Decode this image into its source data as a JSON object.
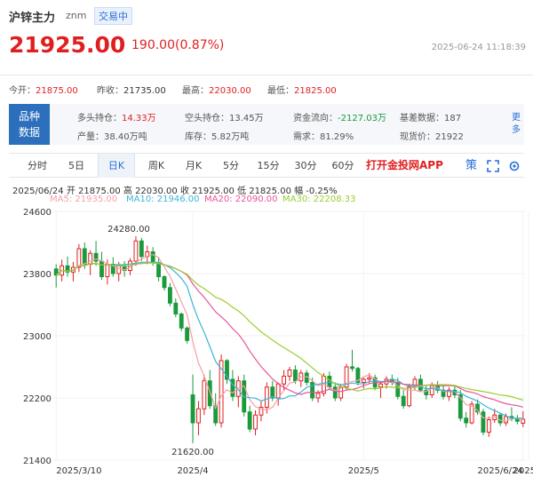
{
  "header": {
    "title": "沪锌主力",
    "code": "znm",
    "status_badge": "交易中",
    "price": "21925.00",
    "change": "190.00(0.87%)",
    "timestamp": "2025-06-24 11:18:39"
  },
  "quote_stats": {
    "open_label": "今开：",
    "open": "21875.00",
    "prev_close_label": "昨收：",
    "prev_close": "21735.00",
    "high_label": "最高：",
    "high": "22030.00",
    "low_label": "最低：",
    "low": "21825.00"
  },
  "info_panel": {
    "label_line1": "品种",
    "label_line2": "数据",
    "long_pos_label": "多头持仓：",
    "long_pos": "14.33万",
    "short_pos_label": "空头持仓：",
    "short_pos": "13.45万",
    "fund_flow_label": "资金流向：",
    "fund_flow": "-2127.03万",
    "basis_label": "基差数据：",
    "basis": "187",
    "output_label": "产量：",
    "output": "38.40万吨",
    "inventory_label": "库存：",
    "inventory": "5.82万吨",
    "demand_label": "需求：",
    "demand": "81.29%",
    "spot_label": "现货价：",
    "spot": "21922",
    "more": "更多"
  },
  "tabs": [
    {
      "label": "分时"
    },
    {
      "label": "5日"
    },
    {
      "label": "日K"
    },
    {
      "label": "周K"
    },
    {
      "label": "月K"
    },
    {
      "label": "5分"
    },
    {
      "label": "15分"
    },
    {
      "label": "30分"
    },
    {
      "label": "60分"
    }
  ],
  "active_tab": "日K",
  "app_link": "打开金投网APP",
  "strategy_icon_label": "策",
  "ohlc_line": "2025/06/24  开 21875.00  高 22030.00  收 21925.00  低 21825.00  幅 -0.25%",
  "ma_legend": [
    {
      "label": "MA5: 21935.00",
      "color": "#f5a0a8"
    },
    {
      "label": "MA10: 21946.00",
      "color": "#3bb5d8"
    },
    {
      "label": "MA20: 22090.00",
      "color": "#e8559a"
    },
    {
      "label": "MA30: 22208.33",
      "color": "#9acd32"
    }
  ],
  "colors": {
    "up": "#e02020",
    "down": "#1a9a3a",
    "accent": "#2a6fd6"
  },
  "chart_data": {
    "type": "candlestick",
    "y_ticks": [
      "24600",
      "23800",
      "23000",
      "22200",
      "21400"
    ],
    "x_ticks": [
      "2025/3/10",
      "2025/4",
      "2025/5",
      "2025/6",
      "2025/6/24"
    ],
    "ylim": [
      21400,
      24600
    ],
    "annotations": [
      {
        "text": "24280.00"
      },
      {
        "text": "21620.00"
      }
    ],
    "candles_ohlc": [
      [
        23860,
        23920,
        23620,
        23780
      ],
      [
        23780,
        23980,
        23700,
        23900
      ],
      [
        23900,
        24020,
        23760,
        23820
      ],
      [
        23820,
        23950,
        23700,
        23880
      ],
      [
        23880,
        24180,
        23820,
        24120
      ],
      [
        24120,
        24200,
        23860,
        23920
      ],
      [
        23920,
        24100,
        23780,
        24060
      ],
      [
        24060,
        24220,
        23900,
        23960
      ],
      [
        23960,
        24080,
        23720,
        23760
      ],
      [
        23760,
        23980,
        23660,
        23920
      ],
      [
        23920,
        24010,
        23760,
        23800
      ],
      [
        23800,
        23950,
        23700,
        23900
      ],
      [
        23900,
        23960,
        23760,
        23840
      ],
      [
        23840,
        24000,
        23780,
        23960
      ],
      [
        23960,
        24280,
        23900,
        24220
      ],
      [
        24220,
        24260,
        23960,
        24020
      ],
      [
        24020,
        24160,
        23920,
        24080
      ],
      [
        24080,
        24140,
        23900,
        23940
      ],
      [
        23940,
        24000,
        23700,
        23760
      ],
      [
        23760,
        23780,
        23580,
        23620
      ],
      [
        23620,
        23680,
        23380,
        23420
      ],
      [
        23420,
        23480,
        23240,
        23280
      ],
      [
        23280,
        23300,
        23060,
        23100
      ],
      [
        23100,
        23120,
        22900,
        22940
      ],
      [
        22240,
        22500,
        21620,
        21880
      ],
      [
        21880,
        22160,
        21720,
        22060
      ],
      [
        22060,
        22500,
        21980,
        22420
      ],
      [
        22420,
        22560,
        22060,
        22100
      ],
      [
        22100,
        22260,
        21840,
        21880
      ],
      [
        21880,
        22760,
        21820,
        22680
      ],
      [
        22680,
        22700,
        22380,
        22440
      ],
      [
        22440,
        22560,
        22160,
        22220
      ],
      [
        22220,
        22480,
        22080,
        22420
      ],
      [
        22420,
        22500,
        21960,
        22020
      ],
      [
        22020,
        22100,
        21760,
        21800
      ],
      [
        21800,
        22040,
        21720,
        21980
      ],
      [
        21980,
        22160,
        21900,
        22080
      ],
      [
        22080,
        22400,
        22000,
        22340
      ],
      [
        22340,
        22420,
        22160,
        22200
      ],
      [
        22200,
        22400,
        22100,
        22380
      ],
      [
        22380,
        22560,
        22300,
        22480
      ],
      [
        22480,
        22600,
        22420,
        22560
      ],
      [
        22560,
        22620,
        22380,
        22420
      ],
      [
        22420,
        22560,
        22340,
        22520
      ],
      [
        22520,
        22560,
        22360,
        22400
      ],
      [
        22400,
        22460,
        22160,
        22200
      ],
      [
        22200,
        22300,
        22140,
        22260
      ],
      [
        22260,
        22520,
        22220,
        22480
      ],
      [
        22480,
        22540,
        22300,
        22340
      ],
      [
        22340,
        22400,
        22160,
        22200
      ],
      [
        22200,
        22380,
        22160,
        22340
      ],
      [
        22340,
        22640,
        22300,
        22600
      ],
      [
        22600,
        22820,
        22540,
        22580
      ],
      [
        22580,
        22600,
        22360,
        22400
      ],
      [
        22400,
        22460,
        22320,
        22440
      ],
      [
        22440,
        22520,
        22380,
        22460
      ],
      [
        22460,
        22500,
        22300,
        22340
      ],
      [
        22340,
        22420,
        22200,
        22380
      ],
      [
        22380,
        22480,
        22320,
        22440
      ],
      [
        22440,
        22500,
        22360,
        22400
      ],
      [
        22400,
        22460,
        22180,
        22220
      ],
      [
        22220,
        22300,
        22060,
        22100
      ],
      [
        22100,
        22380,
        22080,
        22340
      ],
      [
        22340,
        22480,
        22300,
        22440
      ],
      [
        22440,
        22500,
        22280,
        22300
      ],
      [
        22300,
        22360,
        22180,
        22240
      ],
      [
        22240,
        22400,
        22200,
        22360
      ],
      [
        22360,
        22420,
        22260,
        22300
      ],
      [
        22300,
        22360,
        22180,
        22220
      ],
      [
        22220,
        22340,
        22160,
        22300
      ],
      [
        22300,
        22360,
        22200,
        22240
      ],
      [
        22240,
        22300,
        21900,
        21940
      ],
      [
        21940,
        22020,
        21820,
        21880
      ],
      [
        21880,
        22160,
        21860,
        22120
      ],
      [
        22120,
        22180,
        21980,
        22020
      ],
      [
        22020,
        22060,
        21720,
        21760
      ],
      [
        21760,
        21960,
        21700,
        21920
      ],
      [
        21920,
        22060,
        21880,
        21980
      ],
      [
        21980,
        22000,
        21840,
        21880
      ],
      [
        21880,
        22000,
        21840,
        21960
      ],
      [
        21960,
        22080,
        21900,
        21940
      ],
      [
        21940,
        21980,
        21860,
        21900
      ],
      [
        21875,
        22030,
        21825,
        21925
      ]
    ]
  }
}
